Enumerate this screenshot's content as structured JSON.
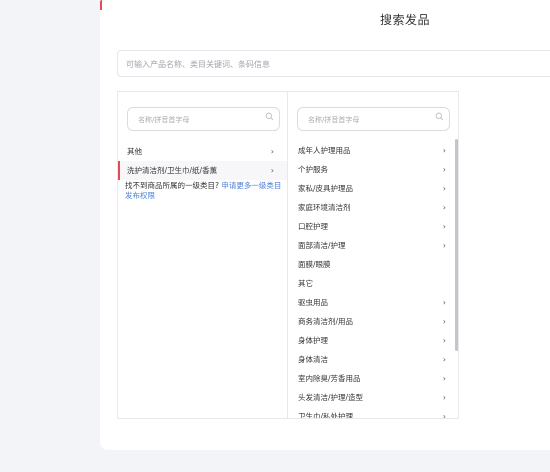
{
  "page": {
    "title": "搜索发品"
  },
  "search": {
    "placeholder": "可输入产品名称、类目关键词、条码信息"
  },
  "column1": {
    "search_placeholder": "名称/拼音首字母",
    "items": [
      {
        "label": "其他",
        "has_children": true,
        "chevron": "›"
      },
      {
        "label": "洗护清洁剂/卫生巾/纸/香薰",
        "has_children": true,
        "chevron": "›",
        "selected": true
      }
    ],
    "note_text": "找不到商品所属的一级类目? ",
    "note_link": "申请更多一级类目发布权限"
  },
  "column2": {
    "search_placeholder": "名称/拼音首字母",
    "items": [
      {
        "label": "成年人护理用品",
        "has_children": true,
        "chevron": "›"
      },
      {
        "label": "个护服务",
        "has_children": true,
        "chevron": "›"
      },
      {
        "label": "家私/皮具护理品",
        "has_children": true,
        "chevron": "›"
      },
      {
        "label": "家庭环境清洁剂",
        "has_children": true,
        "chevron": "›"
      },
      {
        "label": "口腔护理",
        "has_children": true,
        "chevron": "›"
      },
      {
        "label": "面部清洁/护理",
        "has_children": true,
        "chevron": "›"
      },
      {
        "label": "面膜/眼膜",
        "has_children": false,
        "chevron": ""
      },
      {
        "label": "其它",
        "has_children": false,
        "chevron": ""
      },
      {
        "label": "驱虫用品",
        "has_children": true,
        "chevron": "›"
      },
      {
        "label": "商务清洁剂/用品",
        "has_children": true,
        "chevron": "›"
      },
      {
        "label": "身体护理",
        "has_children": true,
        "chevron": "›"
      },
      {
        "label": "身体清洁",
        "has_children": true,
        "chevron": "›"
      },
      {
        "label": "室内除臭/芳香用品",
        "has_children": true,
        "chevron": "›"
      },
      {
        "label": "头发清洁/护理/造型",
        "has_children": true,
        "chevron": "›"
      },
      {
        "label": "卫生巾/私处护理",
        "has_children": true,
        "chevron": "›"
      }
    ]
  },
  "colors": {
    "accent": "#e34b5b",
    "link": "#4a7fd6"
  },
  "icons": {
    "column_search": "search-icon"
  }
}
